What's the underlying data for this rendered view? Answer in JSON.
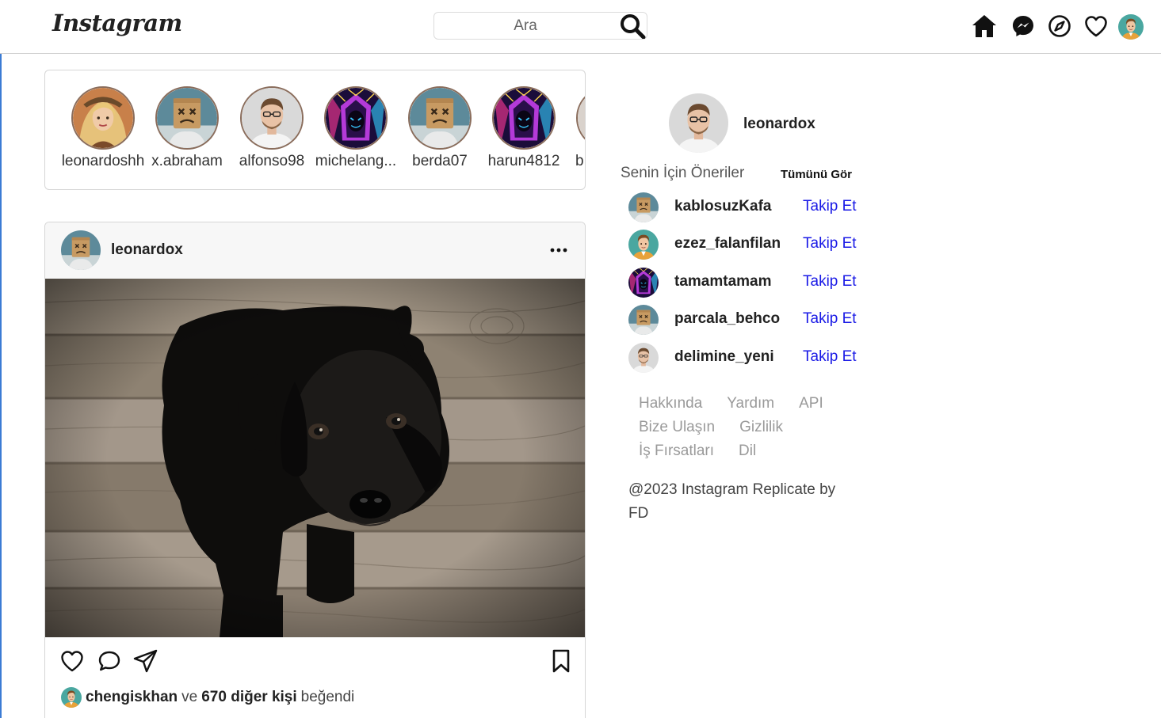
{
  "header": {
    "logo": "Instagram",
    "search_placeholder": "Ara",
    "nav": [
      "home-icon",
      "messenger-icon",
      "explore-icon",
      "heart-icon",
      "profile-avatar"
    ]
  },
  "stories": [
    {
      "name": "leonardoshh",
      "avatar": "blonde-woman"
    },
    {
      "name": "x.abraham",
      "avatar": "box-head"
    },
    {
      "name": "alfonso98",
      "avatar": "glasses-man"
    },
    {
      "name": "michelang...",
      "avatar": "neon-hood"
    },
    {
      "name": "berda07",
      "avatar": "box-head"
    },
    {
      "name": "harun4812",
      "avatar": "neon-hood"
    },
    {
      "name": "b",
      "avatar": "partial"
    }
  ],
  "post": {
    "username": "leonardox",
    "more_label": "...",
    "image_subject": "black puppy on wooden floor",
    "likes": {
      "user": "chengiskhan",
      "connector": "ve",
      "others": "670 diğer kişi",
      "suffix": "beğendi"
    }
  },
  "sidebar": {
    "username": "leonardox",
    "suggestions_title": "Senin İçin Öneriler",
    "see_all": "Tümünü Gör",
    "suggestions": [
      {
        "username": "kablosuzKafa",
        "action": "Takip Et",
        "avatar": "box-head"
      },
      {
        "username": "ezez_falanfilan",
        "action": "Takip Et",
        "avatar": "cartoon-man"
      },
      {
        "username": "tamamtamam",
        "action": "Takip Et",
        "avatar": "neon-hood"
      },
      {
        "username": "parcala_behco",
        "action": "Takip Et",
        "avatar": "box-head"
      },
      {
        "username": "delimine_yeni",
        "action": "Takip Et",
        "avatar": "glasses-man"
      }
    ],
    "footer_links": [
      [
        "Hakkında",
        "Yardım",
        "API"
      ],
      [
        "Bize Ulaşın",
        "Gizlilik"
      ],
      [
        "İş Fırsatları",
        "Dil"
      ]
    ],
    "copyright": "@2023 Instagram Replicate by FD"
  },
  "colors": {
    "link_blue": "#1a1ae6",
    "border": "#d6d6d6",
    "muted": "#9a9a9a"
  }
}
